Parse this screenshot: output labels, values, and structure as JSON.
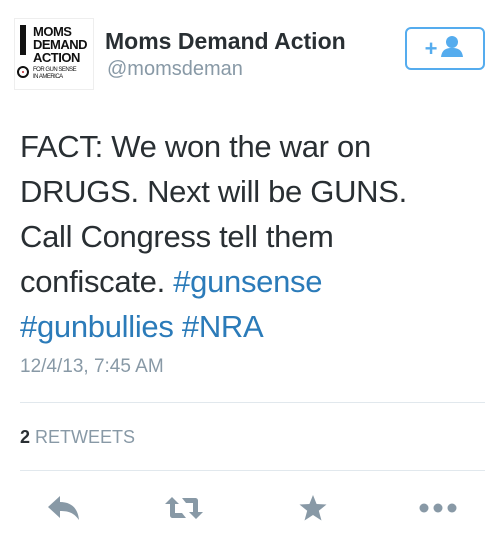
{
  "user": {
    "display_name": "Moms Demand Action",
    "handle": "@momsdeman",
    "avatar_logo": {
      "line1": "MOMS",
      "line2": "DEMAND",
      "line3": "ACTION",
      "sub1": "FOR GUN SENSE",
      "sub2": "IN AMERICA"
    }
  },
  "follow_button": {
    "label": "+",
    "icon": "add-user-icon"
  },
  "tweet": {
    "lines": [
      {
        "text": "FACT: We won the war on",
        "tags": []
      },
      {
        "text": "DRUGS. Next will be GUNS.",
        "tags": []
      },
      {
        "text": "Call Congress tell them",
        "tags": []
      },
      {
        "text": "confiscate. ",
        "tags": [
          "#gunsense"
        ]
      },
      {
        "text": "",
        "tags": [
          "#gunbullies",
          "#NRA"
        ]
      }
    ],
    "timestamp": "12/4/13, 7:45 AM"
  },
  "stats": {
    "retweet_count": "2",
    "retweet_label": "RETWEETS"
  },
  "actions": [
    {
      "name": "reply",
      "icon": "reply-icon"
    },
    {
      "name": "retweet",
      "icon": "retweet-icon"
    },
    {
      "name": "favorite",
      "icon": "star-icon"
    },
    {
      "name": "more",
      "icon": "more-icon"
    }
  ],
  "colors": {
    "text": "#292f33",
    "muted": "#8899a6",
    "link": "#2b7bb9",
    "accent": "#55acee",
    "action_icon": "#8899a6",
    "divider": "#e1e8ed"
  }
}
